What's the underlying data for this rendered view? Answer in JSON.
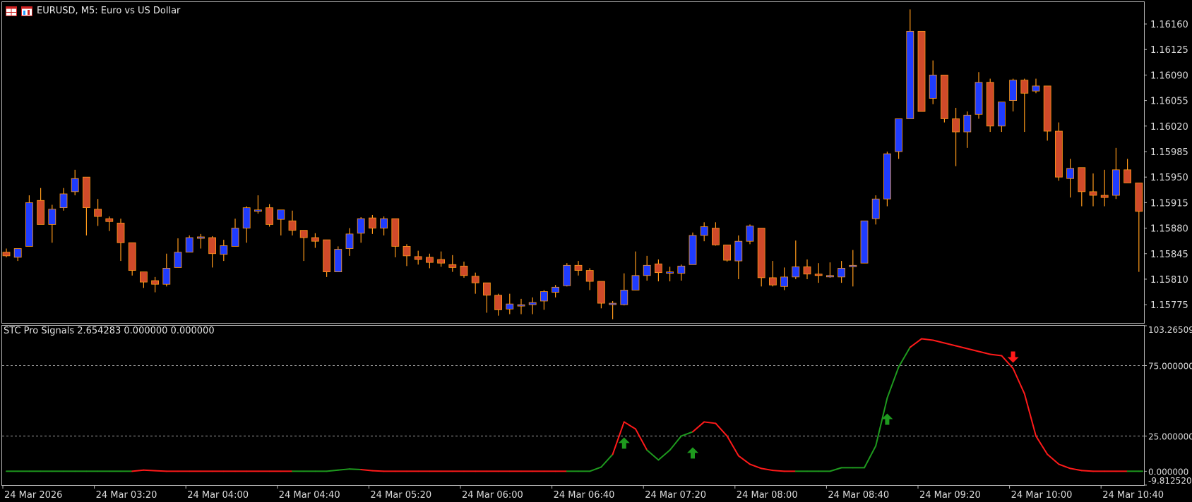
{
  "window": {
    "title": "EURUSD, M5:  Euro vs US Dollar",
    "icons": [
      "chart-grid-icon",
      "chart-window-icon"
    ]
  },
  "indicator": {
    "label": "STC Pro Signals 2.654283 0.000000 0.000000"
  },
  "colors": {
    "background": "#000000",
    "bull": "#1f3cff",
    "bear": "#d04a2a",
    "wick": "#ff9a1a",
    "stc_up": "#1e9a1e",
    "stc_down": "#ff1a1a",
    "grid_dash": "#9a9a9a",
    "frame": "#b8b8b8"
  },
  "chart_data": [
    {
      "type": "candlestick",
      "symbol": "EURUSD",
      "timeframe": "M5",
      "y_ticks": [
        "1.16160",
        "1.16125",
        "1.16090",
        "1.16055",
        "1.16020",
        "1.15985",
        "1.15950",
        "1.15915",
        "1.15880",
        "1.15845",
        "1.15810",
        "1.15775"
      ],
      "ylim": [
        1.1575,
        1.1619
      ],
      "candles": [
        {
          "o": 1.15847,
          "h": 1.15852,
          "l": 1.1584,
          "c": 1.15842
        },
        {
          "o": 1.1584,
          "h": 1.15852,
          "l": 1.15835,
          "c": 1.15852
        },
        {
          "o": 1.15855,
          "h": 1.15925,
          "l": 1.15855,
          "c": 1.15915
        },
        {
          "o": 1.15918,
          "h": 1.15935,
          "l": 1.15885,
          "c": 1.15885
        },
        {
          "o": 1.15885,
          "h": 1.15912,
          "l": 1.1586,
          "c": 1.15906
        },
        {
          "o": 1.15908,
          "h": 1.15935,
          "l": 1.15904,
          "c": 1.15927
        },
        {
          "o": 1.1593,
          "h": 1.1596,
          "l": 1.15925,
          "c": 1.15948
        },
        {
          "o": 1.1595,
          "h": 1.1595,
          "l": 1.1587,
          "c": 1.15908
        },
        {
          "o": 1.15906,
          "h": 1.1592,
          "l": 1.15883,
          "c": 1.15896
        },
        {
          "o": 1.15893,
          "h": 1.15896,
          "l": 1.15876,
          "c": 1.15889
        },
        {
          "o": 1.15887,
          "h": 1.15893,
          "l": 1.15835,
          "c": 1.1586
        },
        {
          "o": 1.1586,
          "h": 1.1586,
          "l": 1.15815,
          "c": 1.15822
        },
        {
          "o": 1.1582,
          "h": 1.1582,
          "l": 1.15798,
          "c": 1.15806
        },
        {
          "o": 1.15808,
          "h": 1.15813,
          "l": 1.15792,
          "c": 1.15803
        },
        {
          "o": 1.15803,
          "h": 1.15845,
          "l": 1.158,
          "c": 1.15825
        },
        {
          "o": 1.15826,
          "h": 1.15866,
          "l": 1.15826,
          "c": 1.15847
        },
        {
          "o": 1.15847,
          "h": 1.1587,
          "l": 1.15847,
          "c": 1.15867
        },
        {
          "o": 1.15866,
          "h": 1.15872,
          "l": 1.15852,
          "c": 1.15868
        },
        {
          "o": 1.15867,
          "h": 1.15869,
          "l": 1.15826,
          "c": 1.15845
        },
        {
          "o": 1.15844,
          "h": 1.15864,
          "l": 1.15835,
          "c": 1.15856
        },
        {
          "o": 1.15855,
          "h": 1.15893,
          "l": 1.15855,
          "c": 1.1588
        },
        {
          "o": 1.1588,
          "h": 1.1591,
          "l": 1.1586,
          "c": 1.15908
        },
        {
          "o": 1.15905,
          "h": 1.15925,
          "l": 1.159,
          "c": 1.15905
        },
        {
          "o": 1.15908,
          "h": 1.15913,
          "l": 1.15882,
          "c": 1.15885
        },
        {
          "o": 1.15892,
          "h": 1.15904,
          "l": 1.1587,
          "c": 1.15905
        },
        {
          "o": 1.1589,
          "h": 1.15904,
          "l": 1.1587,
          "c": 1.15877
        },
        {
          "o": 1.15877,
          "h": 1.15877,
          "l": 1.15835,
          "c": 1.15867
        },
        {
          "o": 1.15867,
          "h": 1.15873,
          "l": 1.15853,
          "c": 1.15862
        },
        {
          "o": 1.15864,
          "h": 1.15864,
          "l": 1.15813,
          "c": 1.1582
        },
        {
          "o": 1.1582,
          "h": 1.15855,
          "l": 1.1582,
          "c": 1.15851
        },
        {
          "o": 1.15852,
          "h": 1.1588,
          "l": 1.15842,
          "c": 1.15872
        },
        {
          "o": 1.15873,
          "h": 1.15895,
          "l": 1.1586,
          "c": 1.15893
        },
        {
          "o": 1.15894,
          "h": 1.15898,
          "l": 1.15872,
          "c": 1.1588
        },
        {
          "o": 1.1588,
          "h": 1.15896,
          "l": 1.1587,
          "c": 1.15893
        },
        {
          "o": 1.15893,
          "h": 1.15893,
          "l": 1.1584,
          "c": 1.15855
        },
        {
          "o": 1.15855,
          "h": 1.15858,
          "l": 1.15828,
          "c": 1.15842
        },
        {
          "o": 1.15841,
          "h": 1.15849,
          "l": 1.1583,
          "c": 1.15837
        },
        {
          "o": 1.1584,
          "h": 1.15845,
          "l": 1.15825,
          "c": 1.15833
        },
        {
          "o": 1.15837,
          "h": 1.15848,
          "l": 1.15827,
          "c": 1.15832
        },
        {
          "o": 1.1583,
          "h": 1.15843,
          "l": 1.1582,
          "c": 1.15826
        },
        {
          "o": 1.15828,
          "h": 1.15834,
          "l": 1.15812,
          "c": 1.15815
        },
        {
          "o": 1.15814,
          "h": 1.15819,
          "l": 1.1579,
          "c": 1.15805
        },
        {
          "o": 1.15805,
          "h": 1.15805,
          "l": 1.15764,
          "c": 1.15788
        },
        {
          "o": 1.15788,
          "h": 1.1579,
          "l": 1.1576,
          "c": 1.15768
        },
        {
          "o": 1.15769,
          "h": 1.1579,
          "l": 1.15762,
          "c": 1.15776
        },
        {
          "o": 1.15775,
          "h": 1.15783,
          "l": 1.15762,
          "c": 1.15775
        },
        {
          "o": 1.15775,
          "h": 1.15785,
          "l": 1.15762,
          "c": 1.15778
        },
        {
          "o": 1.1578,
          "h": 1.15795,
          "l": 1.15768,
          "c": 1.15793
        },
        {
          "o": 1.15792,
          "h": 1.15802,
          "l": 1.15785,
          "c": 1.15799
        },
        {
          "o": 1.15801,
          "h": 1.15832,
          "l": 1.158,
          "c": 1.15829
        },
        {
          "o": 1.15829,
          "h": 1.15835,
          "l": 1.15815,
          "c": 1.15822
        },
        {
          "o": 1.15822,
          "h": 1.15825,
          "l": 1.15795,
          "c": 1.15807
        },
        {
          "o": 1.15807,
          "h": 1.15807,
          "l": 1.1577,
          "c": 1.15777
        },
        {
          "o": 1.15777,
          "h": 1.1578,
          "l": 1.15755,
          "c": 1.15777
        },
        {
          "o": 1.15775,
          "h": 1.15818,
          "l": 1.15774,
          "c": 1.15795
        },
        {
          "o": 1.15795,
          "h": 1.15848,
          "l": 1.15795,
          "c": 1.15815
        },
        {
          "o": 1.15815,
          "h": 1.15842,
          "l": 1.15808,
          "c": 1.15829
        },
        {
          "o": 1.15831,
          "h": 1.15837,
          "l": 1.15807,
          "c": 1.15819
        },
        {
          "o": 1.15819,
          "h": 1.15827,
          "l": 1.15807,
          "c": 1.1582
        },
        {
          "o": 1.15818,
          "h": 1.1583,
          "l": 1.15808,
          "c": 1.15828
        },
        {
          "o": 1.1583,
          "h": 1.15874,
          "l": 1.1583,
          "c": 1.1587
        },
        {
          "o": 1.1587,
          "h": 1.15888,
          "l": 1.15862,
          "c": 1.15882
        },
        {
          "o": 1.1588,
          "h": 1.15888,
          "l": 1.15856,
          "c": 1.15857
        },
        {
          "o": 1.15857,
          "h": 1.15857,
          "l": 1.15834,
          "c": 1.15836
        },
        {
          "o": 1.15835,
          "h": 1.1587,
          "l": 1.1581,
          "c": 1.15862
        },
        {
          "o": 1.15862,
          "h": 1.15885,
          "l": 1.15858,
          "c": 1.15883
        },
        {
          "o": 1.1588,
          "h": 1.1588,
          "l": 1.158,
          "c": 1.15812
        },
        {
          "o": 1.15812,
          "h": 1.15835,
          "l": 1.158,
          "c": 1.15802
        },
        {
          "o": 1.158,
          "h": 1.15826,
          "l": 1.15795,
          "c": 1.15813
        },
        {
          "o": 1.15813,
          "h": 1.15863,
          "l": 1.1581,
          "c": 1.15827
        },
        {
          "o": 1.15827,
          "h": 1.15837,
          "l": 1.1581,
          "c": 1.15817
        },
        {
          "o": 1.15817,
          "h": 1.15832,
          "l": 1.15805,
          "c": 1.15815
        },
        {
          "o": 1.15815,
          "h": 1.15833,
          "l": 1.15812,
          "c": 1.15815
        },
        {
          "o": 1.15813,
          "h": 1.15835,
          "l": 1.15805,
          "c": 1.15825
        },
        {
          "o": 1.15828,
          "h": 1.1585,
          "l": 1.158,
          "c": 1.15829
        },
        {
          "o": 1.15832,
          "h": 1.1589,
          "l": 1.15832,
          "c": 1.1589
        },
        {
          "o": 1.15893,
          "h": 1.15925,
          "l": 1.15885,
          "c": 1.1592
        },
        {
          "o": 1.1592,
          "h": 1.15985,
          "l": 1.1591,
          "c": 1.15982
        },
        {
          "o": 1.15985,
          "h": 1.1603,
          "l": 1.15975,
          "c": 1.1603
        },
        {
          "o": 1.1603,
          "h": 1.1618,
          "l": 1.1603,
          "c": 1.1615
        },
        {
          "o": 1.1615,
          "h": 1.1615,
          "l": 1.1604,
          "c": 1.1604
        },
        {
          "o": 1.16058,
          "h": 1.1611,
          "l": 1.1605,
          "c": 1.1609
        },
        {
          "o": 1.1609,
          "h": 1.1609,
          "l": 1.16025,
          "c": 1.1603
        },
        {
          "o": 1.1603,
          "h": 1.16045,
          "l": 1.15965,
          "c": 1.16012
        },
        {
          "o": 1.16012,
          "h": 1.1604,
          "l": 1.1599,
          "c": 1.16035
        },
        {
          "o": 1.16036,
          "h": 1.16094,
          "l": 1.1603,
          "c": 1.1608
        },
        {
          "o": 1.1608,
          "h": 1.16085,
          "l": 1.16012,
          "c": 1.1602
        },
        {
          "o": 1.1602,
          "h": 1.1605,
          "l": 1.16012,
          "c": 1.16053
        },
        {
          "o": 1.16055,
          "h": 1.16085,
          "l": 1.1604,
          "c": 1.16083
        },
        {
          "o": 1.16083,
          "h": 1.16085,
          "l": 1.16012,
          "c": 1.16065
        },
        {
          "o": 1.16068,
          "h": 1.16085,
          "l": 1.16065,
          "c": 1.16075
        },
        {
          "o": 1.16075,
          "h": 1.16075,
          "l": 1.16,
          "c": 1.16013
        },
        {
          "o": 1.16013,
          "h": 1.16025,
          "l": 1.15945,
          "c": 1.1595
        },
        {
          "o": 1.15948,
          "h": 1.15975,
          "l": 1.15922,
          "c": 1.15962
        },
        {
          "o": 1.15963,
          "h": 1.15963,
          "l": 1.1591,
          "c": 1.1593
        },
        {
          "o": 1.1593,
          "h": 1.15955,
          "l": 1.1591,
          "c": 1.15925
        },
        {
          "o": 1.15925,
          "h": 1.1596,
          "l": 1.1591,
          "c": 1.15922
        },
        {
          "o": 1.15925,
          "h": 1.1599,
          "l": 1.1592,
          "c": 1.1596
        },
        {
          "o": 1.1596,
          "h": 1.15975,
          "l": 1.15942,
          "c": 1.15942
        },
        {
          "o": 1.15942,
          "h": 1.15942,
          "l": 1.1582,
          "c": 1.15903
        },
        {
          "o": 1.15901,
          "h": 1.1591,
          "l": 1.1585,
          "c": 1.15888
        },
        {
          "o": 1.15885,
          "h": 1.1593,
          "l": 1.1587,
          "c": 1.15925
        },
        {
          "o": 1.15925,
          "h": 1.1594,
          "l": 1.1583,
          "c": 1.1587
        }
      ]
    },
    {
      "type": "line",
      "name": "STC Pro Signals",
      "y_ticks": [
        "103.265092",
        "75.000000",
        "25.000000",
        "0.000000",
        "-9.812520"
      ],
      "ylim": [
        -9.81252,
        103.265092
      ],
      "levels": [
        75,
        25
      ],
      "x_ticks": [
        "24 Mar 2026",
        "24 Mar 03:20",
        "24 Mar 04:00",
        "24 Mar 04:40",
        "24 Mar 05:20",
        "24 Mar 06:00",
        "24 Mar 06:40",
        "24 Mar 07:20",
        "24 Mar 08:00",
        "24 Mar 08:40",
        "24 Mar 09:20",
        "24 Mar 10:00",
        "24 Mar 10:40"
      ],
      "x_tick_bars": [
        0,
        8,
        16,
        24,
        32,
        40,
        48,
        56,
        64,
        72,
        80,
        88,
        96
      ],
      "values": [
        0,
        0,
        0,
        0,
        0,
        0,
        0,
        0,
        0,
        0,
        0,
        0,
        0.8,
        0.4,
        0,
        0,
        0,
        0,
        0,
        0,
        0,
        0,
        0,
        0,
        0,
        0,
        0,
        0,
        0,
        0.8,
        1.6,
        1.2,
        0.4,
        0,
        0,
        0,
        0,
        0,
        0,
        0,
        0,
        0,
        0,
        0,
        0,
        0,
        0,
        0,
        0,
        0,
        0,
        0,
        3,
        12,
        35,
        30,
        15,
        8,
        15,
        25,
        28,
        35,
        34,
        25,
        11,
        5,
        2,
        0.6,
        0,
        0,
        0,
        0,
        0,
        2.5,
        2.5,
        2.5,
        18,
        52,
        74,
        88,
        94,
        93,
        91,
        89,
        87,
        85,
        83,
        82,
        73,
        55,
        25,
        12,
        5,
        2,
        0.5,
        0,
        0,
        0,
        0,
        0,
        0,
        1.5
      ],
      "trend_changes": [
        {
          "start": 0,
          "dir": "up"
        },
        {
          "start": 12,
          "dir": "down"
        },
        {
          "start": 26,
          "dir": "up"
        },
        {
          "start": 32,
          "dir": "down"
        },
        {
          "start": 50,
          "dir": "up"
        },
        {
          "start": 54,
          "dir": "down"
        },
        {
          "start": 57,
          "dir": "up"
        },
        {
          "start": 61,
          "dir": "down"
        },
        {
          "start": 70,
          "dir": "up"
        },
        {
          "start": 80,
          "dir": "down"
        },
        {
          "start": 99,
          "dir": "up"
        }
      ],
      "signals": [
        {
          "bar": 54,
          "type": "buy"
        },
        {
          "bar": 60,
          "type": "buy"
        },
        {
          "bar": 77,
          "type": "buy"
        },
        {
          "bar": 88,
          "type": "sell"
        }
      ]
    }
  ]
}
